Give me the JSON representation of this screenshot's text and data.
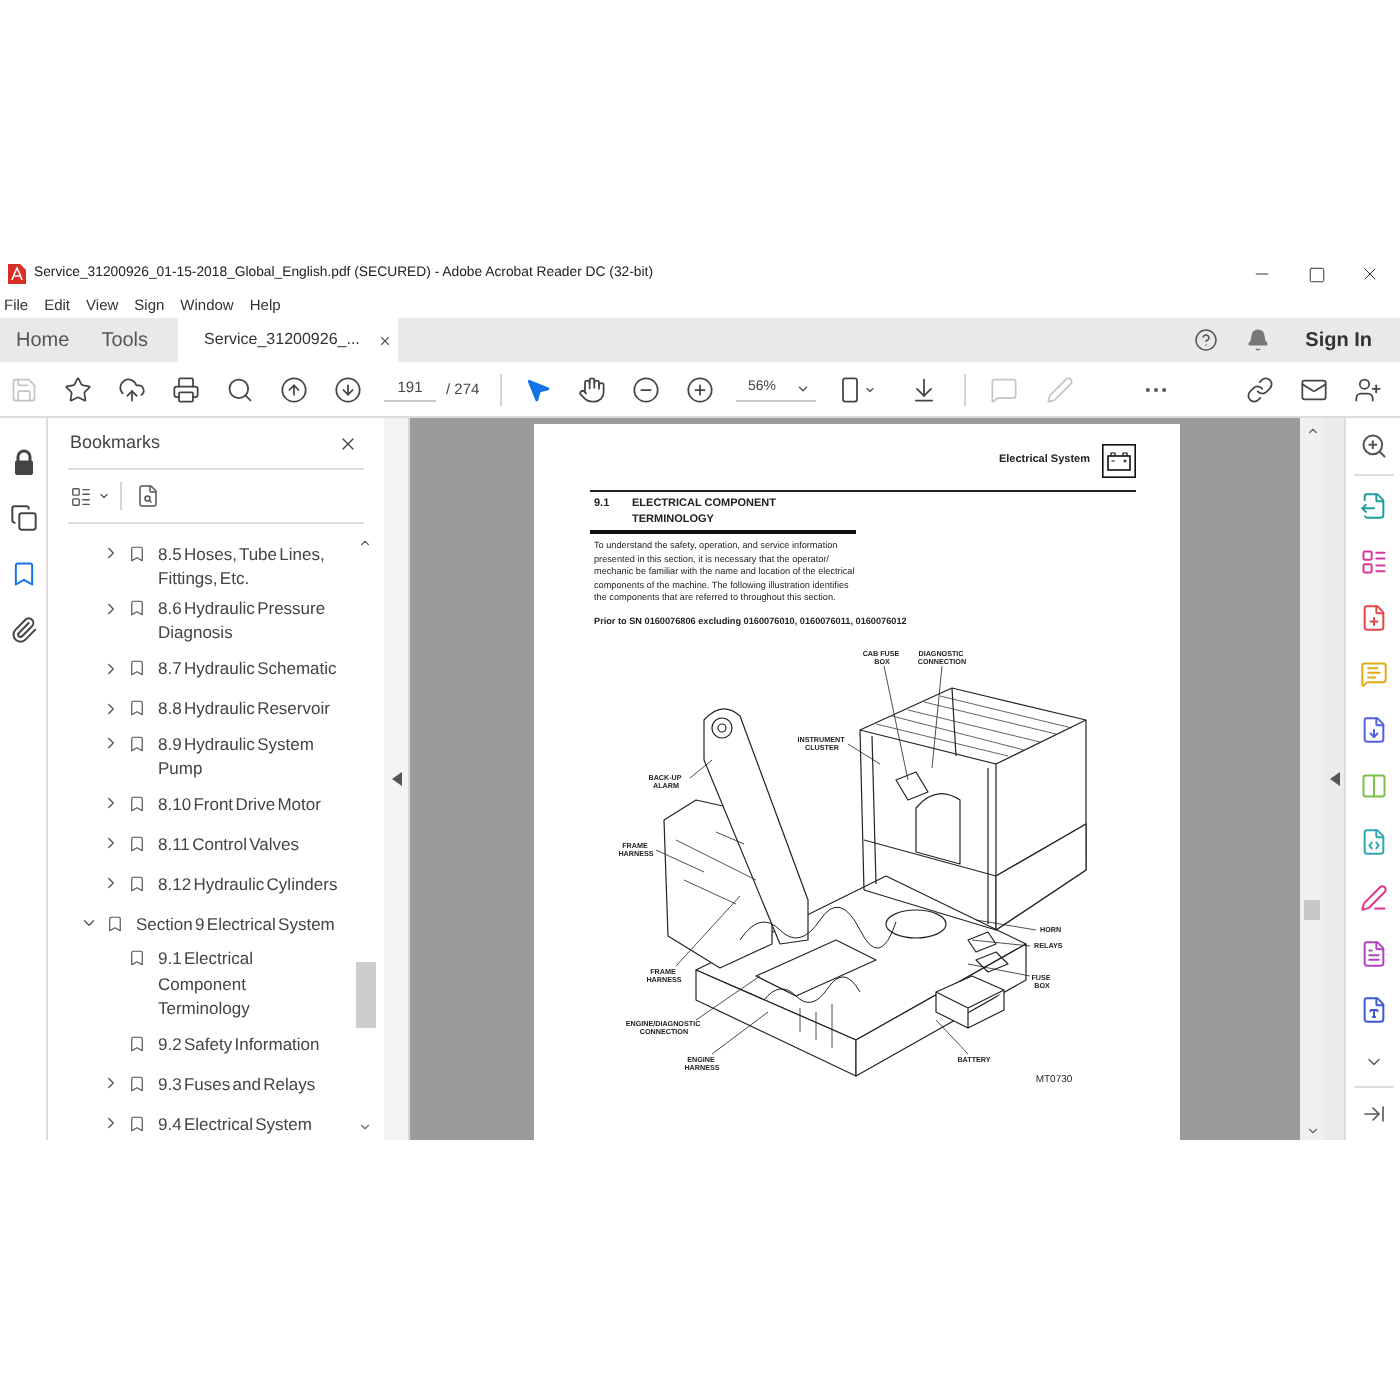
{
  "window": {
    "title": "Service_31200926_01-15-2018_Global_English.pdf (SECURED) - Adobe Acrobat Reader DC (32-bit)"
  },
  "menu": [
    "File",
    "Edit",
    "View",
    "Sign",
    "Window",
    "Help"
  ],
  "tabs": [
    {
      "label": "Home",
      "selected": false,
      "closable": false
    },
    {
      "label": "Tools",
      "selected": false,
      "closable": false
    },
    {
      "label": "Service_31200926_...",
      "selected": true,
      "closable": true
    }
  ],
  "account": {
    "sign_in": "Sign In"
  },
  "toolbar": {
    "save": {
      "disabled": true
    },
    "page": {
      "value": "191",
      "total": "/ 274"
    },
    "tools": [
      {
        "selected": true
      },
      {
        "selected": false
      }
    ],
    "zoom": {
      "value": "56%"
    },
    "annotate": [
      {
        "disabled": true
      },
      {
        "disabled": true
      }
    ]
  },
  "nav_panel": [
    {
      "selected": false
    },
    {
      "selected": false
    },
    {
      "selected": true
    },
    {
      "selected": false
    }
  ],
  "bookmarks": {
    "title": "Bookmarks",
    "tree": [
      {
        "children": [
          {
            "label": "8.5 Hoses, Tube Lines, Fittings, Etc.",
            "kind": "branch",
            "expanded": false
          },
          {
            "label": "8.6 Hydraulic Pressure Diagnosis",
            "kind": "branch",
            "expanded": false
          },
          {
            "label": "8.7 Hydraulic Schematic",
            "kind": "branch",
            "expanded": false
          },
          {
            "label": "8.8 Hydraulic Reservoir",
            "kind": "branch",
            "expanded": false
          },
          {
            "label": "8.9 Hydraulic System Pump",
            "kind": "branch",
            "expanded": false
          },
          {
            "label": "8.10 Front Drive Motor",
            "kind": "branch",
            "expanded": false
          },
          {
            "label": "8.11 Control Valves",
            "kind": "branch",
            "expanded": false
          },
          {
            "label": "8.12 Hydraulic Cylinders",
            "kind": "branch",
            "expanded": false
          }
        ]
      },
      {
        "label": "Section 9 Electrical System",
        "kind": "branch",
        "expanded": true,
        "children": [
          {
            "label": "9.1 Electrical Component Terminology",
            "kind": "leaf"
          },
          {
            "label": "9.2 Safety Information",
            "kind": "leaf"
          },
          {
            "label": "9.3 Fuses and Relays",
            "kind": "branch",
            "expanded": false
          },
          {
            "label": "9.4 Electrical System",
            "kind": "branch",
            "expanded": false
          }
        ]
      }
    ]
  },
  "document": {
    "running_head": "Electrical System",
    "section": {
      "number": "9.1",
      "title": "ELECTRICAL COMPONENT TERMINOLOGY"
    },
    "intro": "To understand the safety, operation, and service information presented in this section, it is necessary that the operator/ mechanic be familiar with the name and location of the electrical components of the machine. The following illustration identifies the components that are referred to throughout this section.",
    "applicability": "Prior to SN 0160076806 excluding 0160076010, 0160076011, 0160076012",
    "figure": {
      "callouts": [
        "CAB FUSE BOX",
        "DIAGNOSTIC CONNECTION",
        "INSTRUMENT CLUSTER",
        "BACK-UP ALARM",
        "FRAME HARNESS",
        "HORN",
        "RELAYS",
        "FUSE BOX",
        "FRAME HARNESS",
        "ENGINE/DIAGNOSTIC CONNECTION",
        "ENGINE HARNESS",
        "BATTERY"
      ],
      "figure_id": "MT0730"
    }
  }
}
